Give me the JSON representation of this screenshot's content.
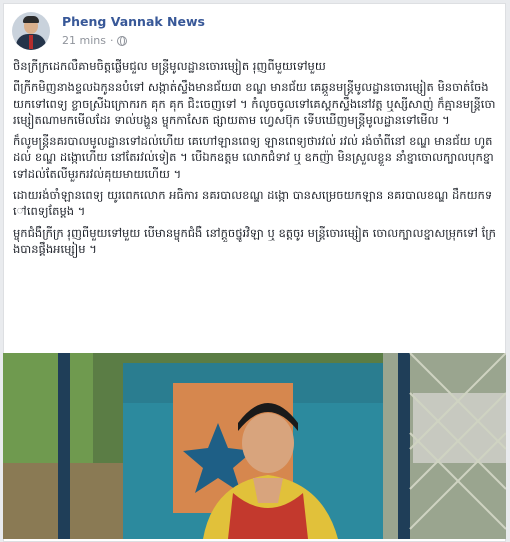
{
  "post": {
    "page_name": "Pheng Vannak News",
    "timestamp": "21 mins",
    "privacy_icon": "globe-icon",
    "paragraphs": [
      "ថិនក្រីក្រ​ដេក​លឺ​គាម​ចិ​ត្ត​ផ្លើម​ជួល​ មន្ត្រី​មូលដ្ឋាន​ចោរ​ម្សៀត​ រុញ​ពី​មួយ​ទៅ​មួយ",
      "ពី​ក្រីក​មិញ​នាង​ខ្ទល​ឯ​កូ​ន​ន​បំ​ទៅ ​សង្កាត់​ស្ទឹង​មាន​ជ័យ៣ ខណ្ឌ មាន​ជ័យ គេ​ឆ្កួ​ន​មន្ត្រី​មូលដ្ឋាន​ចោរ​ម្សៀត មិន​ចាត់​ចែង​យក​ទៅ​ពេទ្យ ខ្លាច​ស្រី​ឯ​ក្រោក​រក គុក គុក ជិះ​ចេញ​ទៅ ។ កំលូ​ច​ចូល​ទៅ​គេ​ស្តក​ស្ទឹង​នៅ​វត្ត ឬ​ស្សី​សាញ់ ក៏​គ្មាន​មន្ត្រី​ចោរ​ម្សៀត​ណា​មក​មើល​ដែរ ទាល់​បង្ហួ​ន ម្ចុ​ក​កា​សែ​ត ផ្សាយ​តាម ហ្វេសប៊ុក ទើប​ឃើញ​មន្ត្រី​មូលដ្ឋាន​ទៅ​មើល ។",
      "ក៏​លូ​មន្ត្រី​នគរបាល​មូលដ្ឋាន​ទៅ​ដល់​ហើយ គេ​ហៅ​ឡាន​ពេទ្យ ឡាន​ពេទ្យ​ថា​រវល់ រវល់ រង់​ចាំ​ពី​នៅ ខណ្ឌ មាន​ជ័យ ហូ​ត​ដល់ ខណ្ឌ ដង្កោ​ហើយ នៅ​តែ​រវល់​ទៀត ។ បើ​ឯក​ឧត្តម លោក​ជំទាវ ឬ ឧក​ញ៉ា មិន​ស្រួល​ខ្លួន នាំ​ខ្នា​ចោល​ក្បាល​បុក​ខ្នា​ទៅ​ដល់​តែ​លី​មួ​រ​ក​រវល់​គុយ​មាយ​ហើយ ។",
      "ដោយ​រង់​ចាំ​ឡាន​ពេទ្យ យូរ​ពេក​លោក អធិការ នគរបាល​ខណ្ឌ ដង្កោ បាន​សម្រេច​យក​ឡាន នគរបាល​ខណ្ឌ ដឹក​យក​ទៅ​ពេទ្យ​តែ​ម្តង ។",
      "ម្ចុ​ក​ជំ​ងឺ​ក្រីក្រ រុញ​ពី​មួយ​ទៅ​មួយ បើ​មាន​ម្ចុ​ក​ជំ​ងឺ នៅ​ក្ដួ​ច​ថ្នូ​រ​វិ​ឡា ឬ ឧត្ត​ចូ​រ មន្ត្រី​ចោរ​ម្សៀត ចោល​ក្បាល​ខ្នា​សម្រុ​ក​ទៅ ក្រែង​បាន​ផ្គឹង​អម្សៀម ។"
    ],
    "photo_alt_icon": "photo-of-woman-in-tuk-tuk"
  },
  "colors": {
    "page_name": "#385898",
    "meta": "#90949c",
    "text": "#1d2129",
    "background": "#e9ebee"
  }
}
